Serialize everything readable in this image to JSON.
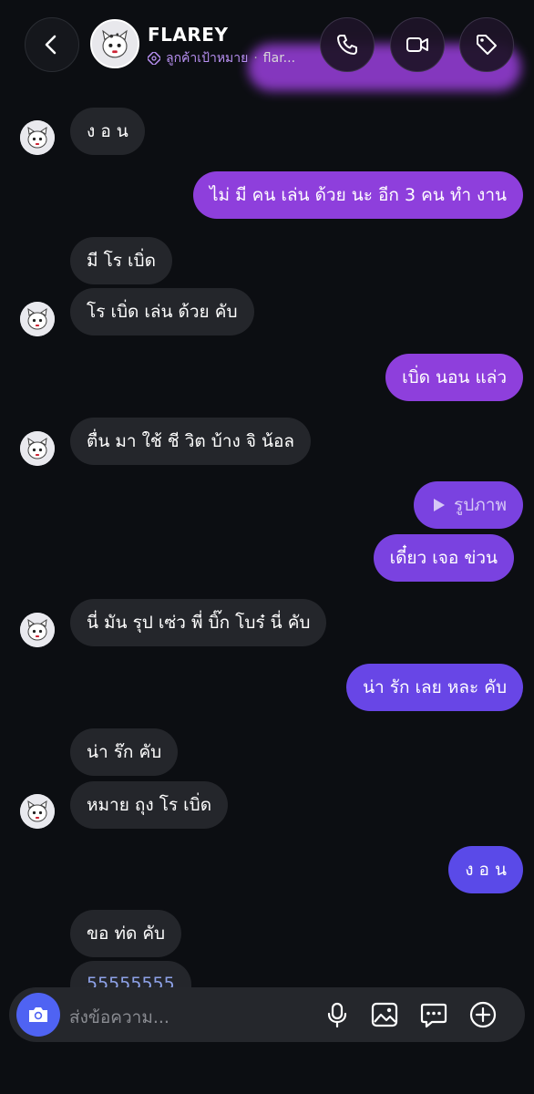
{
  "header": {
    "contact_name": "FLAREY",
    "badge_label": "ลูกค้าเป้าหมาย",
    "separator": "·",
    "handle": "flar..."
  },
  "messages": [
    {
      "side": "in",
      "text": "ง อ น"
    },
    {
      "side": "out",
      "text": "ไม่ มี คน เล่น ด้วย นะ อีก 3 คน ทำ งาน"
    },
    {
      "side": "in",
      "text": "มี โร เบิ่ด"
    },
    {
      "side": "in",
      "text": "โร เบิ่ด เล่น ด้วย คับ"
    },
    {
      "side": "out",
      "text": "เบิ่ด นอน แล่ว"
    },
    {
      "side": "in",
      "text": "ตื่น มา ใช้ ชี วิต บ้าง จิ น้อล"
    },
    {
      "side": "out",
      "text": "รูปภาพ",
      "type": "media"
    },
    {
      "side": "out",
      "text": "เดี๋ยว เจอ ข่วน"
    },
    {
      "side": "in",
      "text": "นี่ มัน รุป เซ่ว พี่ บิ๊ก โบร๋ นี่ คับ"
    },
    {
      "side": "out",
      "text": "น่า รัก เลย หละ คับ"
    },
    {
      "side": "in",
      "text": "น่า ร๊ก คับ"
    },
    {
      "side": "in",
      "text": "หมาย ถุง โร เบิ่ด"
    },
    {
      "side": "out",
      "text": "ง อ น"
    },
    {
      "side": "in",
      "text": "ขอ ท่ด คับ"
    },
    {
      "side": "in",
      "text": "55555555",
      "type": "link"
    }
  ],
  "composer": {
    "placeholder": "ส่งข้อความ..."
  },
  "colors": {
    "background": "#0c0e12",
    "incoming_bubble": "#24262b",
    "outgoing_gradient": [
      "#8e3fdc",
      "#5a4ae8"
    ],
    "camera_button": "#4f63f3",
    "badge_text": "#b890f2"
  },
  "icons": {
    "back": "chevron-left-icon",
    "call": "phone-icon",
    "video": "video-camera-icon",
    "tag": "tag-icon",
    "camera": "camera-icon",
    "mic": "microphone-icon",
    "gallery": "image-icon",
    "sticker": "chat-bubble-icon",
    "add": "plus-circle-icon"
  }
}
